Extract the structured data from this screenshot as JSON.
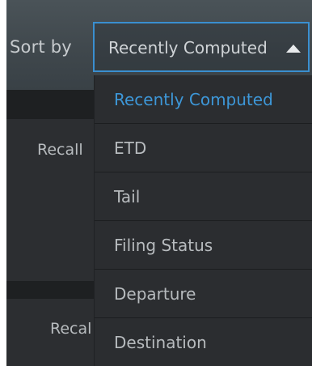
{
  "sort": {
    "label": "Sort by",
    "selected_value": "Recently Computed",
    "arrow_icon": "caret-up-icon",
    "accent_color": "#3a8fd0",
    "options": [
      {
        "label": "Recently Computed",
        "selected": true
      },
      {
        "label": "ETD",
        "selected": false
      },
      {
        "label": "Tail",
        "selected": false
      },
      {
        "label": "Filing Status",
        "selected": false
      },
      {
        "label": "Departure",
        "selected": false
      },
      {
        "label": "Destination",
        "selected": false
      }
    ]
  },
  "list": {
    "rows": [
      {
        "recall_label": "Recall"
      },
      {
        "recall_label": "Recal"
      }
    ]
  }
}
